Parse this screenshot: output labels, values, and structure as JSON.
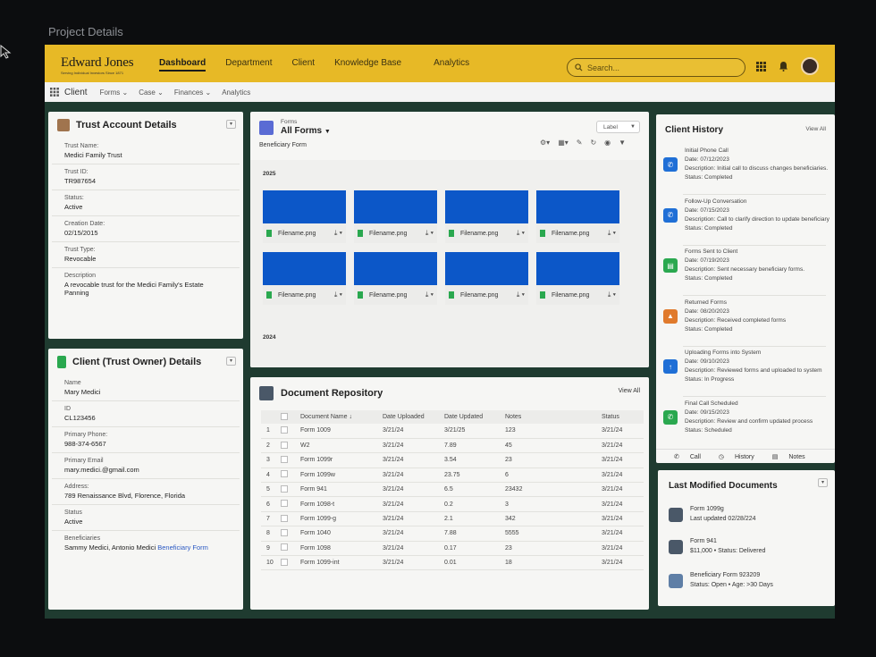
{
  "page": {
    "title": "Project Details"
  },
  "topbar": {
    "logo": "Edward Jones",
    "logo_tagline": "Serving Individual Investors Since 1871",
    "nav": [
      {
        "label": "Dashboard",
        "active": true
      },
      {
        "label": "Department"
      },
      {
        "label": "Client"
      },
      {
        "label": "Knowledge Base"
      },
      {
        "label": "Analytics"
      }
    ],
    "search_placeholder": "Search...",
    "icons": [
      "grid-icon",
      "bell-icon",
      "avatar"
    ]
  },
  "subnav": {
    "client": "Client",
    "items": [
      "Forms",
      "Case",
      "Finances",
      "Analytics"
    ]
  },
  "trust_account": {
    "title": "Trust Account Details",
    "fields": [
      {
        "label": "Trust Name:",
        "value": "Medici Family Trust"
      },
      {
        "label": "Trust ID:",
        "value": "TR987654"
      },
      {
        "label": "Status:",
        "value": "Active"
      },
      {
        "label": "Creation Date:",
        "value": "02/15/2015"
      },
      {
        "label": "Trust Type:",
        "value": "Revocable"
      },
      {
        "label": "Description",
        "value": "A revocable trust for the Medici Family's Estate Panning"
      }
    ]
  },
  "client_details": {
    "title": "Client (Trust Owner) Details",
    "fields": [
      {
        "label": "Name",
        "value": "Mary Medici"
      },
      {
        "label": "ID",
        "value": "CL123456"
      },
      {
        "label": "Primary Phone:",
        "value": "988-374-6567"
      },
      {
        "label": "Primary Email",
        "value": "mary.medici.@gmail.com"
      },
      {
        "label": "Address:",
        "value": "789 Renaissance Blvd, Florence, Florida"
      },
      {
        "label": "Status",
        "value": "Active"
      }
    ],
    "beneficiaries_label": "Beneficiaries",
    "beneficiaries_value": "Sammy Medici, Antonio Medici",
    "beneficiaries_link": "Beneficiary Form"
  },
  "forms": {
    "eyebrow": "Forms",
    "title": "All Forms",
    "subtitle": "Beneficiary Form",
    "label_button": "Label",
    "year_1": "2025",
    "year_2": "2024",
    "tiles": [
      {
        "name": "Filename.png"
      },
      {
        "name": "Filename.png"
      },
      {
        "name": "Filename.png"
      },
      {
        "name": "Filename.png"
      },
      {
        "name": "Filename.png"
      },
      {
        "name": "Filename.png"
      },
      {
        "name": "Filename.png"
      },
      {
        "name": "Filename.png"
      }
    ]
  },
  "repository": {
    "title": "Document Repository",
    "view_all": "View All",
    "columns": [
      "Document Name",
      "Date Uploaded",
      "Date Updated",
      "Notes",
      "Status"
    ],
    "rows": [
      {
        "n": "1",
        "name": "Form 1009",
        "uploaded": "3/21/24",
        "updated": "3/21/25",
        "notes": "123",
        "status": "3/21/24"
      },
      {
        "n": "2",
        "name": "W2",
        "uploaded": "3/21/24",
        "updated": "7.89",
        "notes": "45",
        "status": "3/21/24"
      },
      {
        "n": "3",
        "name": "Form 1099r",
        "uploaded": "3/21/24",
        "updated": "3.54",
        "notes": "23",
        "status": "3/21/24"
      },
      {
        "n": "4",
        "name": "Form 1099w",
        "uploaded": "3/21/24",
        "updated": "23.75",
        "notes": "6",
        "status": "3/21/24"
      },
      {
        "n": "5",
        "name": "Form 941",
        "uploaded": "3/21/24",
        "updated": "6.5",
        "notes": "23432",
        "status": "3/21/24"
      },
      {
        "n": "6",
        "name": "Form 1098-t",
        "uploaded": "3/21/24",
        "updated": "0.2",
        "notes": "3",
        "status": "3/21/24"
      },
      {
        "n": "7",
        "name": "Form 1099-g",
        "uploaded": "3/21/24",
        "updated": "2.1",
        "notes": "342",
        "status": "3/21/24"
      },
      {
        "n": "8",
        "name": "Form 1040",
        "uploaded": "3/21/24",
        "updated": "7.88",
        "notes": "5555",
        "status": "3/21/24"
      },
      {
        "n": "9",
        "name": "Form 1098",
        "uploaded": "3/21/24",
        "updated": "0.17",
        "notes": "23",
        "status": "3/21/24"
      },
      {
        "n": "10",
        "name": "Form 1099-int",
        "uploaded": "3/21/24",
        "updated": "0.01",
        "notes": "18",
        "status": "3/21/24"
      }
    ]
  },
  "history": {
    "title": "Client History",
    "view_all": "View All",
    "items": [
      {
        "title": "Initial Phone Call",
        "date": "Date: 07/12/2023",
        "desc": "Description: Initial call to discuss changes beneficiaries.",
        "status": "Status: Completed",
        "color": "#1f6fd6"
      },
      {
        "title": "Follow-Up Conversation",
        "date": "Date: 07/15/2023",
        "desc": "Description: Call to clarify direction to update beneficiary",
        "status": "Status: Completed",
        "color": "#1f6fd6"
      },
      {
        "title": "Forms Sent to Client",
        "date": "Date: 07/19/2023",
        "desc": "Description: Sent necessary beneficiary forms.",
        "status": "Status: Completed",
        "color": "#2aa84f"
      },
      {
        "title": "Returned Forms",
        "date": "Date: 08/20/2023",
        "desc": "Description: Received completed forms",
        "status": "Status: Completed",
        "color": "#e07a2c"
      },
      {
        "title": "Uploading Forms into System",
        "date": "Date: 09/10/2023",
        "desc": "Description: Reviewed forms and uploaded to system",
        "status": "Status: In Progress",
        "color": "#1f6fd6"
      },
      {
        "title": "Final Call Scheduled",
        "date": "Date: 09/15/2023",
        "desc": "Description: Review and confirm updated process",
        "status": "Status: Scheduled",
        "color": "#2aa84f"
      }
    ],
    "tabs": [
      "Call",
      "History",
      "Notes"
    ]
  },
  "last_modified": {
    "title": "Last Modified Documents",
    "items": [
      {
        "line1": "Form 1099g",
        "line2": "Last updated 02/28/224"
      },
      {
        "line1": "Form 941",
        "line2": "$11,000 • Status: Delivered"
      },
      {
        "line1": "Beneficiary Form 923209",
        "line2": "Status: Open • Age: >30 Days"
      }
    ]
  }
}
